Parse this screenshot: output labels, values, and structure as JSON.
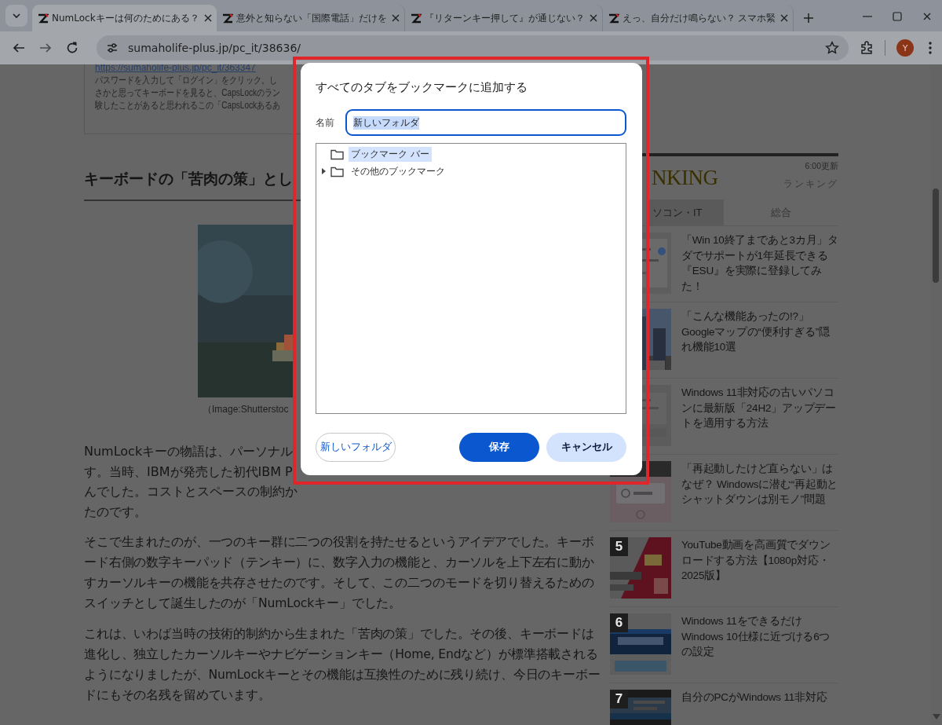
{
  "browser": {
    "tabs": [
      {
        "title": "NumLockキーは何のためにある？",
        "selected": true
      },
      {
        "title": "意外と知らない「国際電話」だけを",
        "selected": false
      },
      {
        "title": "『リターンキー押して』が通じない？",
        "selected": false
      },
      {
        "title": "えっ、自分だけ鳴らない？ スマホ緊",
        "selected": false
      }
    ],
    "url": "sumaholife-plus.jp/pc_it/38636/",
    "avatar": "Y"
  },
  "article": {
    "link": "https://sumaholife-plus.jp/pc_it/363347",
    "box_lines": [
      "パスワードを入力して「ログイン」をクリック。し",
      "さかと思ってキーボードを見ると、CapsLockのラン",
      "験したことがあると思われるこの「CapsLockあるあ"
    ],
    "heading": "キーボードの「苦肉の策」とし",
    "caption": "（Image:Shutterstoc",
    "cut_lines": [
      "NumLockキーの物語は、パーソナル",
      "す。当時、IBMが発売した初代IBM P",
      "んでした。コストとスペースの制約か",
      "たのです。"
    ],
    "paragraphs": [
      "そこで生まれたのが、一つのキー群に二つの役割を持たせるというアイデアでした。キーボード右側の数字キーパッド（テンキー）に、数字入力の機能と、カーソルを上下左右に動かすカーソルキーの機能を共存させたのです。そして、この二つのモードを切り替えるためのスイッチとして誕生したのが「NumLockキー」でした。",
      "これは、いわば当時の技術的制約から生まれた「苦肉の策」でした。その後、キーボードは進化し、独立したカーソルキーやナビゲーションキー（Home, Endなど）が標準搭載されるようになりましたが、NumLockキーとその機能は互換性のために残り続け、今日のキーボードにもその名残を留めています。"
    ]
  },
  "sidebar": {
    "updated": "6:00更新",
    "logo": "NKING",
    "subtitle": "ランキング",
    "tabs": [
      {
        "label": "ソコン・IT",
        "selected": true
      },
      {
        "label": "総合",
        "selected": false
      }
    ],
    "items": [
      {
        "title": "「Win 10終了まであと3カ月」タダでサポートが1年延長できる『ESU』を実際に登録してみた！"
      },
      {
        "title": "「こんな機能あったの!?」Googleマップの“便利すぎる”隠れ機能10選"
      },
      {
        "title": "Windows 11非対応の古いパソコンに最新版「24H2」アップデートを適用する方法"
      },
      {
        "title": "「再起動したけど直らない」はなぜ？ Windowsに潜む“再起動とシャットダウンは別モノ”問題"
      },
      {
        "rank": "5",
        "title": "YouTube動画を高画質でダウンロードする方法【1080p対応・2025版】"
      },
      {
        "rank": "6",
        "title": "Windows 11をできるだけWindows 10仕様に近づける6つの設定"
      },
      {
        "rank": "7",
        "title": "自分のPCがWindows 11非対応"
      }
    ]
  },
  "dialog": {
    "title": "すべてのタブをブックマークに追加する",
    "name_label": "名前",
    "name_value": "新しいフォルダ",
    "folders": [
      {
        "label": "ブックマーク バー",
        "selected": true,
        "expandable": false
      },
      {
        "label": "その他のブックマーク",
        "selected": false,
        "expandable": true
      }
    ],
    "buttons": [
      {
        "label": "新しいフォルダ",
        "kind": "outline"
      },
      {
        "label": "保存",
        "kind": "primary"
      },
      {
        "label": "キャンセル",
        "kind": "tonal"
      }
    ]
  }
}
